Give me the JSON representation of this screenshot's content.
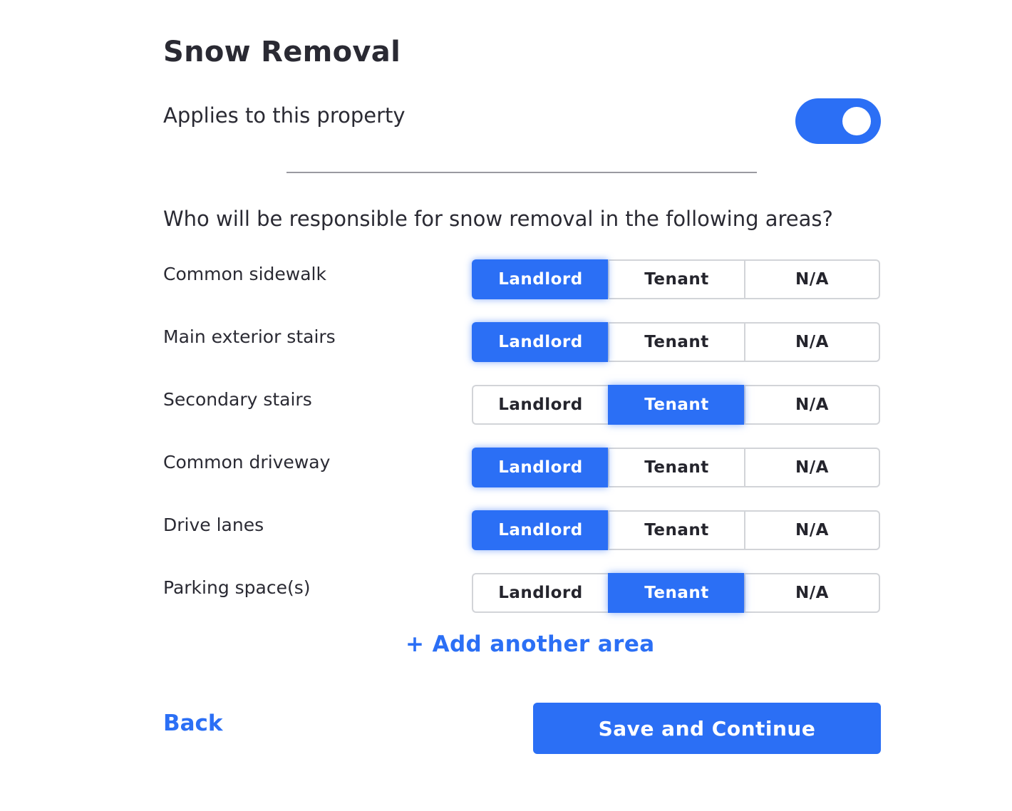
{
  "page": {
    "title": "Snow Removal",
    "applies_label": "Applies to this property",
    "applies_toggle_on": true,
    "question": "Who will be responsible for snow removal in the following areas?"
  },
  "options": [
    "Landlord",
    "Tenant",
    "N/A"
  ],
  "areas": [
    {
      "label": "Common sidewalk",
      "selected": "Landlord"
    },
    {
      "label": "Main exterior stairs",
      "selected": "Landlord"
    },
    {
      "label": "Secondary stairs",
      "selected": "Tenant"
    },
    {
      "label": "Common driveway",
      "selected": "Landlord"
    },
    {
      "label": "Drive lanes",
      "selected": "Landlord"
    },
    {
      "label": "Parking space(s)",
      "selected": "Tenant"
    }
  ],
  "actions": {
    "add_area": "+ Add another area",
    "back": "Back",
    "save": "Save and Continue"
  },
  "colors": {
    "accent": "#2b6ff5",
    "text": "#2a2a33",
    "border": "#d2d4d8"
  }
}
